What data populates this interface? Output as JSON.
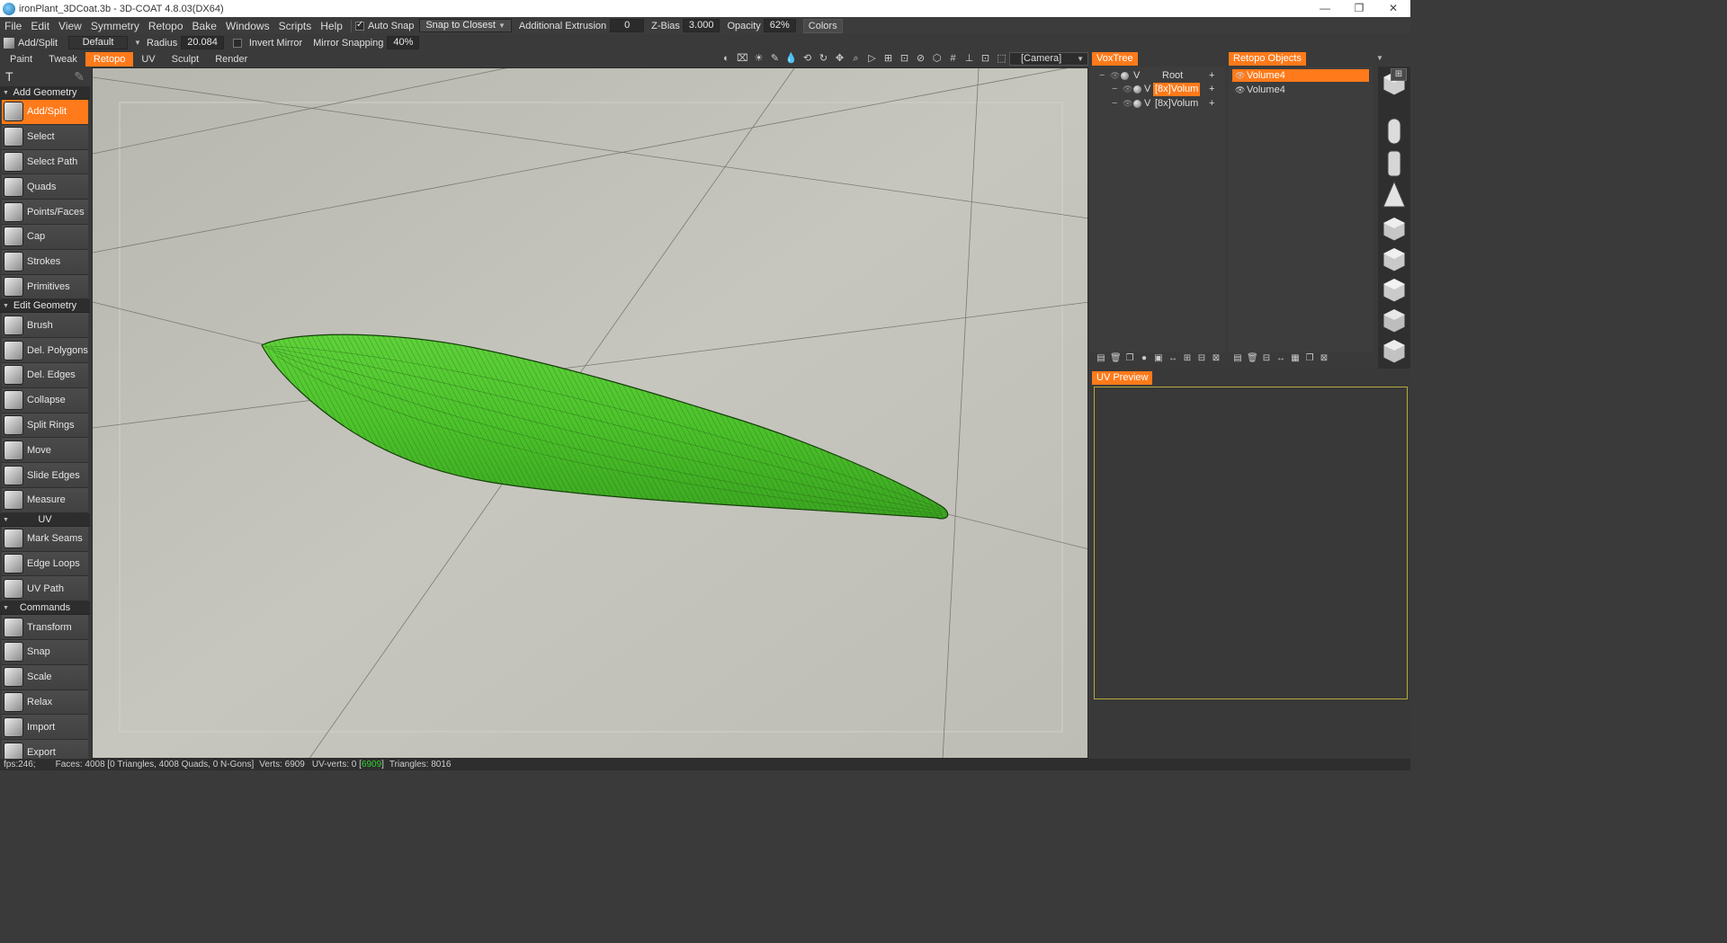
{
  "window": {
    "title": "ironPlant_3DCoat.3b - 3D-COAT 4.8.03(DX64)",
    "controls": [
      "—",
      "❐",
      "✕"
    ]
  },
  "menubar": {
    "items": [
      "File",
      "Edit",
      "View",
      "Symmetry",
      "Retopo",
      "Bake",
      "Windows",
      "Scripts",
      "Help"
    ],
    "auto_snap_label": "Auto Snap",
    "snap_mode": "Snap to Closest",
    "extrusion_label": "Additional Extrusion",
    "extrusion_value": "0",
    "zbias_label": "Z-Bias",
    "zbias_value": "3.000",
    "opacity_label": "Opacity",
    "opacity_value": "62%",
    "colors_label": "Colors"
  },
  "tooloptions": {
    "tool_name": "Add/Split",
    "preset": "Default",
    "radius_label": "Radius",
    "radius_value": "20.084",
    "invert_mirror_label": "Invert Mirror",
    "mirror_snapping_label": "Mirror Snapping",
    "mirror_snapping_value": "40%"
  },
  "rooms": {
    "tabs": [
      "Paint",
      "Tweak",
      "Retopo",
      "UV",
      "Sculpt",
      "Render"
    ],
    "active": "Retopo",
    "camera": "[Camera]"
  },
  "viewport_icons": [
    "◐",
    "⌧",
    "☀",
    "✎",
    "💧",
    "⟲",
    "↻",
    "✥",
    "⌕",
    "▷",
    "⊞",
    "⊡",
    "⊘",
    "⬡",
    "#",
    "⊥",
    "⊡",
    "⬚"
  ],
  "leftpanel": {
    "sections": [
      {
        "title": "Add Geometry",
        "tools": [
          "Add/Split",
          "Select",
          "Select Path",
          "Quads",
          "Points/Faces",
          "Cap",
          "Strokes",
          "Primitives"
        ]
      },
      {
        "title": "Edit Geometry",
        "tools": [
          "Brush",
          "Del. Polygons",
          "Del. Edges",
          "Collapse",
          "Split Rings",
          "Move",
          "Slide Edges",
          "Measure"
        ]
      },
      {
        "title": "UV",
        "tools": [
          "Mark Seams",
          "Edge Loops",
          "UV Path"
        ]
      },
      {
        "title": "Commands",
        "tools": [
          "Transform",
          "Snap",
          "Scale",
          "Relax",
          "Import",
          "Export"
        ]
      }
    ],
    "active_tool": "Add/Split"
  },
  "voxtree": {
    "title": "VoxTree",
    "rows": [
      {
        "name": "Root",
        "selected": false
      },
      {
        "name": "[8x]Volum",
        "selected": true
      },
      {
        "name": "[8x]Volum",
        "selected": false
      }
    ]
  },
  "retopo_objects": {
    "title": "Retopo Objects",
    "rows": [
      {
        "name": "Volume4",
        "selected": true
      },
      {
        "name": "Volume4",
        "selected": false
      }
    ]
  },
  "uv_preview": {
    "title": "UV Preview"
  },
  "statusbar": {
    "fps": "fps:246;",
    "faces": "Faces: 4008 [0 Triangles, 4008 Quads, 0 N-Gons]",
    "verts": "Verts: 6909",
    "uv_verts_label": "UV-verts: 0 [",
    "uv_verts_highlight": "6909",
    "uv_verts_close": "]",
    "triangles": "Triangles: 8016"
  },
  "colors": {
    "accent": "#ff7a1a",
    "mesh_green": "#4ec42c",
    "viewport_bg": "#c2c2ba"
  }
}
